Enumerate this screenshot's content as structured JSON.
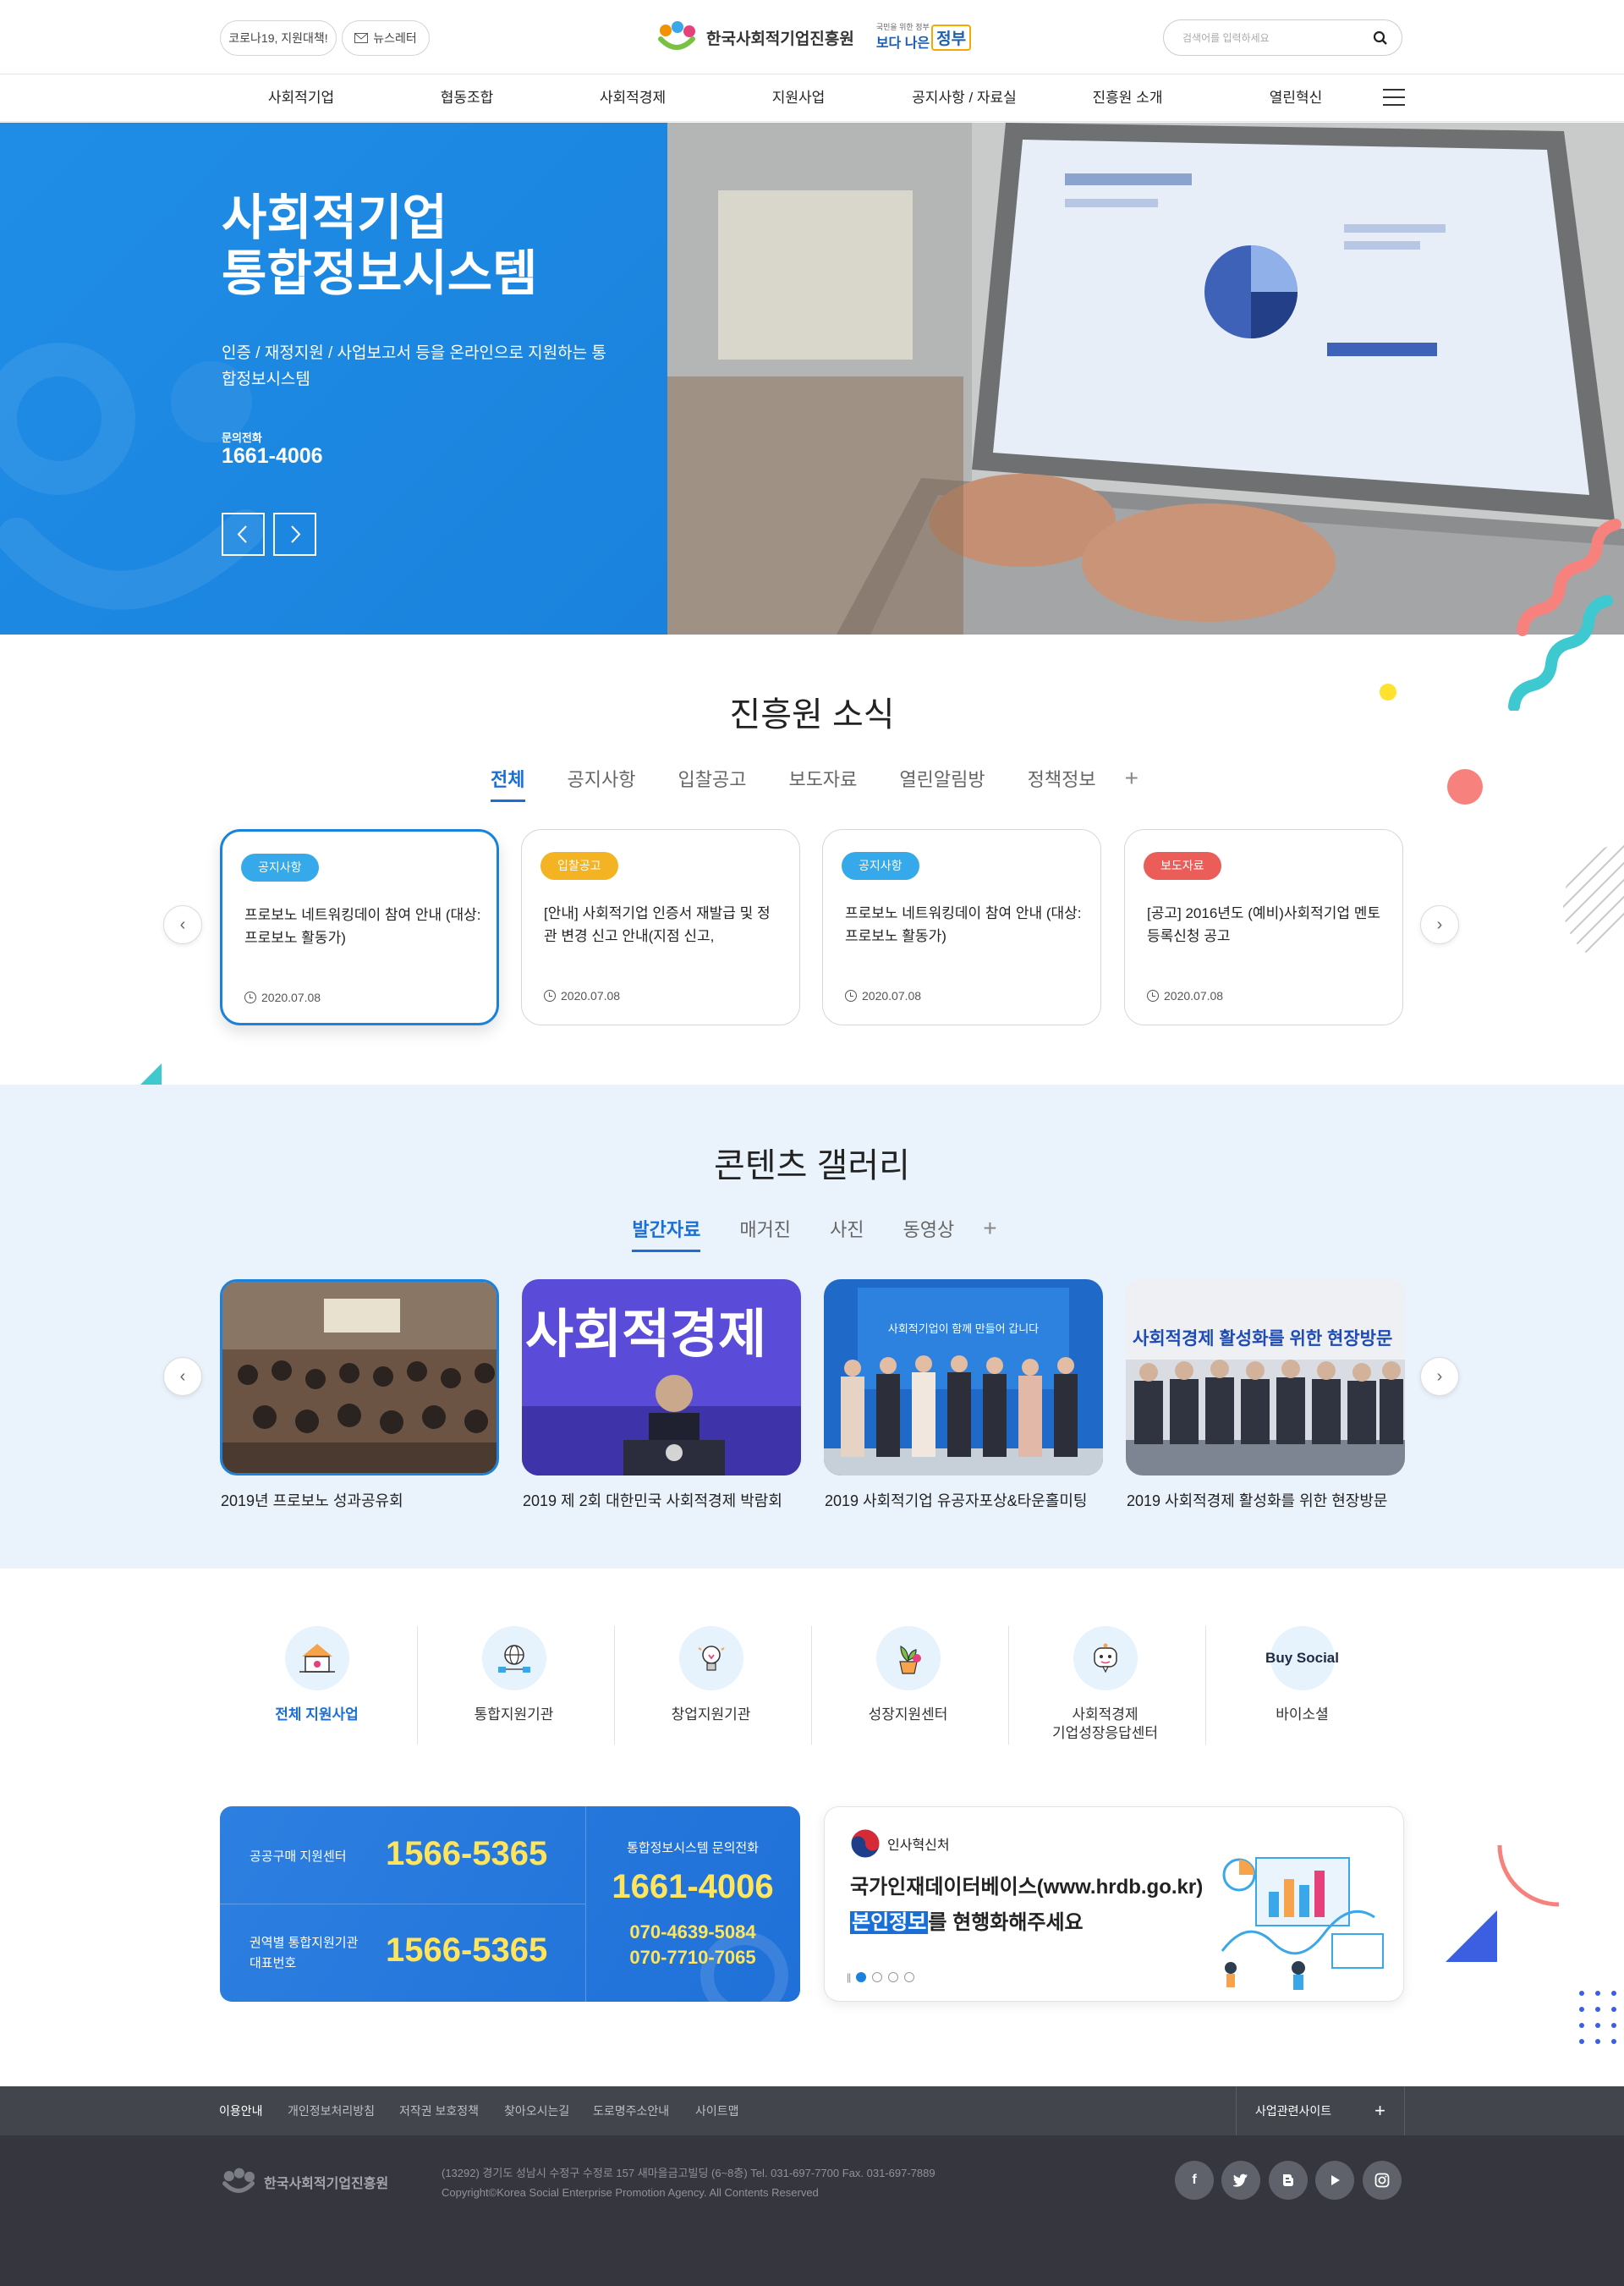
{
  "header": {
    "pill_covid": "코로나19, 지원대책!",
    "pill_newsletter": "뉴스레터",
    "org_name": "한국사회적기업진흥원",
    "gov_small_1": "국민을 위한 정부",
    "gov_small_2": "보다 나은",
    "gov_big": "정부",
    "search_placeholder": "검색어를 입력하세요"
  },
  "nav": [
    "사회적기업",
    "협동조합",
    "사회적경제",
    "지원사업",
    "공지사항 / 자료실",
    "진흥원 소개",
    "열린혁신"
  ],
  "hero": {
    "title_line1": "사회적기업",
    "title_line2": "통합정보시스템",
    "desc": "인증 / 재정지원 / 사업보고서 등을 온라인으로 지원하는 통합정보시스템",
    "phone_label": "문의전화",
    "phone": "1661-4006"
  },
  "news": {
    "title": "진흥원 소식",
    "tabs": [
      "전체",
      "공지사항",
      "입찰공고",
      "보도자료",
      "열린알림방",
      "정책정보"
    ],
    "cards": [
      {
        "badge": "공지사항",
        "badge_color": "#35a9e9",
        "title": "프로보노 네트워킹데이 참여 안내 (대상: 프로보노 활동가)",
        "date": "2020.07.08"
      },
      {
        "badge": "입찰공고",
        "badge_color": "#f3b322",
        "title": "[안내] 사회적기업 인증서 재발급 및 정관 변경 신고 안내(지점 신고,",
        "date": "2020.07.08"
      },
      {
        "badge": "공지사항",
        "badge_color": "#35a9e9",
        "title": "프로보노 네트워킹데이 참여 안내 (대상: 프로보노 활동가)",
        "date": "2020.07.08"
      },
      {
        "badge": "보도자료",
        "badge_color": "#ea5d58",
        "title": "[공고] 2016년도 (예비)사회적기업 멘토 등록신청 공고",
        "date": "2020.07.08"
      }
    ]
  },
  "gallery": {
    "title": "콘텐츠 갤러리",
    "tabs": [
      "발간자료",
      "매거진",
      "사진",
      "동영상"
    ],
    "items": [
      {
        "caption": "2019년 프로보노 성과공유회"
      },
      {
        "caption": "2019 제 2회 대한민국 사회적경제 박람회",
        "overlay": "사회적경제"
      },
      {
        "caption": "2019 사회적기업 유공자포상&타운홀미팅",
        "overlay": "사회적기업이 함께 만들어 갑니다"
      },
      {
        "caption": "2019 사회적경제 활성화를 위한 현장방문",
        "overlay": "사회적경제 활성화를 위한 현장방문"
      }
    ]
  },
  "quick": [
    {
      "label": "전체 지원사업",
      "icon": "house-icon"
    },
    {
      "label": "통합지원기관",
      "icon": "globe-network-icon"
    },
    {
      "label": "창업지원기관",
      "icon": "lightbulb-icon"
    },
    {
      "label": "성장지원센터",
      "icon": "plant-icon"
    },
    {
      "label": "사회적경제\n기업성장응답센터",
      "icon": "chat-robot-icon"
    },
    {
      "label": "바이소셜",
      "icon": "buysocial-logo",
      "logo_text": "Buy Social"
    }
  ],
  "contact": {
    "row1_label": "공공구매 지원센터",
    "row1_phone": "1566-5365",
    "row2_label_1": "권역별 통합지원기관",
    "row2_label_2": "대표번호",
    "row2_phone": "1566-5365",
    "right_label": "통합정보시스템 문의전화",
    "right_phone": "1661-4006",
    "right_sub1": "070-4639-5084",
    "right_sub2": "070-7710-7065"
  },
  "banner": {
    "org": "인사혁신처",
    "line1": "국가인재데이터베이스(www.hrdb.go.kr)",
    "line2_highlight": "본인정보",
    "line2_rest": "를 현행화해주세요"
  },
  "footer": {
    "links": [
      "이용안내",
      "개인정보처리방침",
      "저작권 보호정책",
      "찾아오시는길",
      "도로명주소안내",
      "사이트맵"
    ],
    "related": "사업관련사이트",
    "org": "한국사회적기업진흥원",
    "address": "(13292) 경기도 성남시 수정구 수정로 157 새마을금고빌딩 (6~8층) Tel. 031-697-7700 Fax. 031-697-7889",
    "copyright": "Copyright©Korea Social Enterprise Promotion Agency. All Contents Reserved"
  },
  "colors": {
    "primary": "#1a82dc",
    "accent_yellow": "#ffd94a",
    "footer": "#36373e"
  }
}
